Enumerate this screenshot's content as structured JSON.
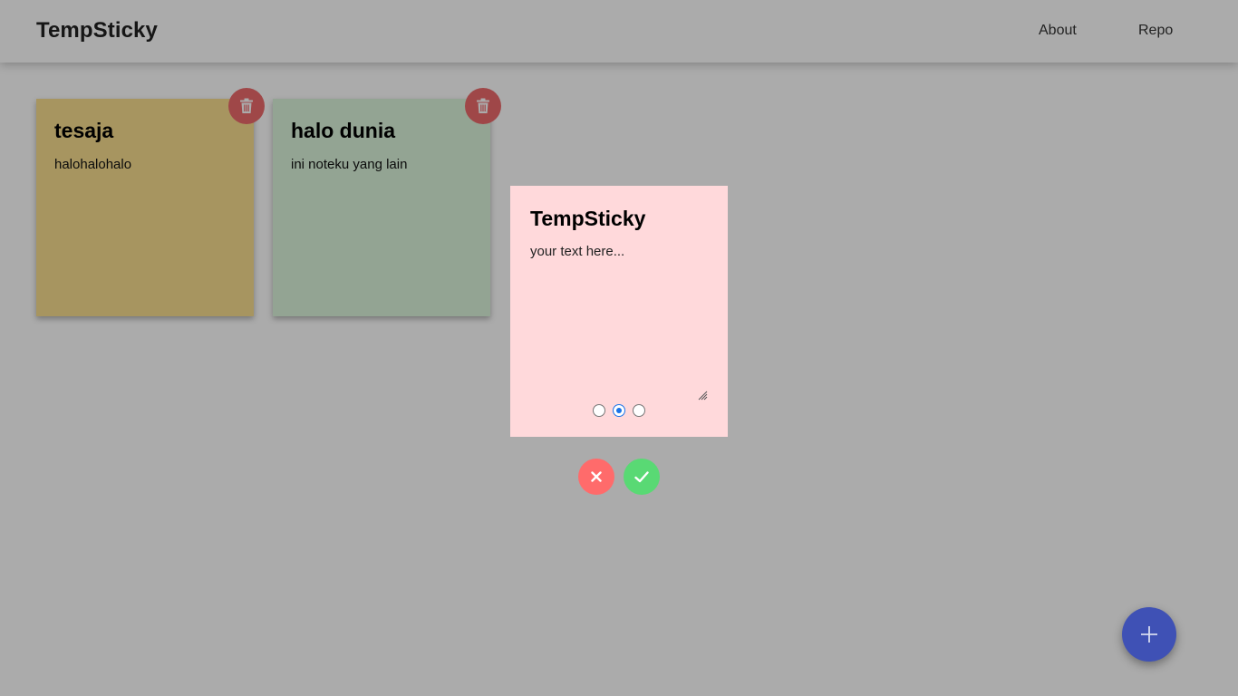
{
  "header": {
    "brand": "TempSticky",
    "nav": [
      {
        "label": "About"
      },
      {
        "label": "Repo"
      }
    ]
  },
  "notes": [
    {
      "title": "tesaja",
      "body": "halohalohalo",
      "color": "#f9df8f"
    },
    {
      "title": "halo dunia",
      "body": "ini noteku yang lain",
      "color": "#dcf5dc"
    }
  ],
  "editor": {
    "title_value": "TempSticky",
    "text_placeholder": "your text here...",
    "color": "#ffd9db",
    "color_options": [
      "yellow",
      "pink",
      "green"
    ],
    "selected_color_index": 1
  },
  "icons": {
    "delete": "trash-icon",
    "cancel": "close-icon",
    "confirm": "check-icon",
    "add": "plus-icon"
  },
  "colors": {
    "delete_button": "#ee6a6c",
    "cancel_button": "#ff6b6b",
    "confirm_button": "#59d974",
    "fab": "#3f51b5",
    "radio_selected": "#1a73e8"
  }
}
